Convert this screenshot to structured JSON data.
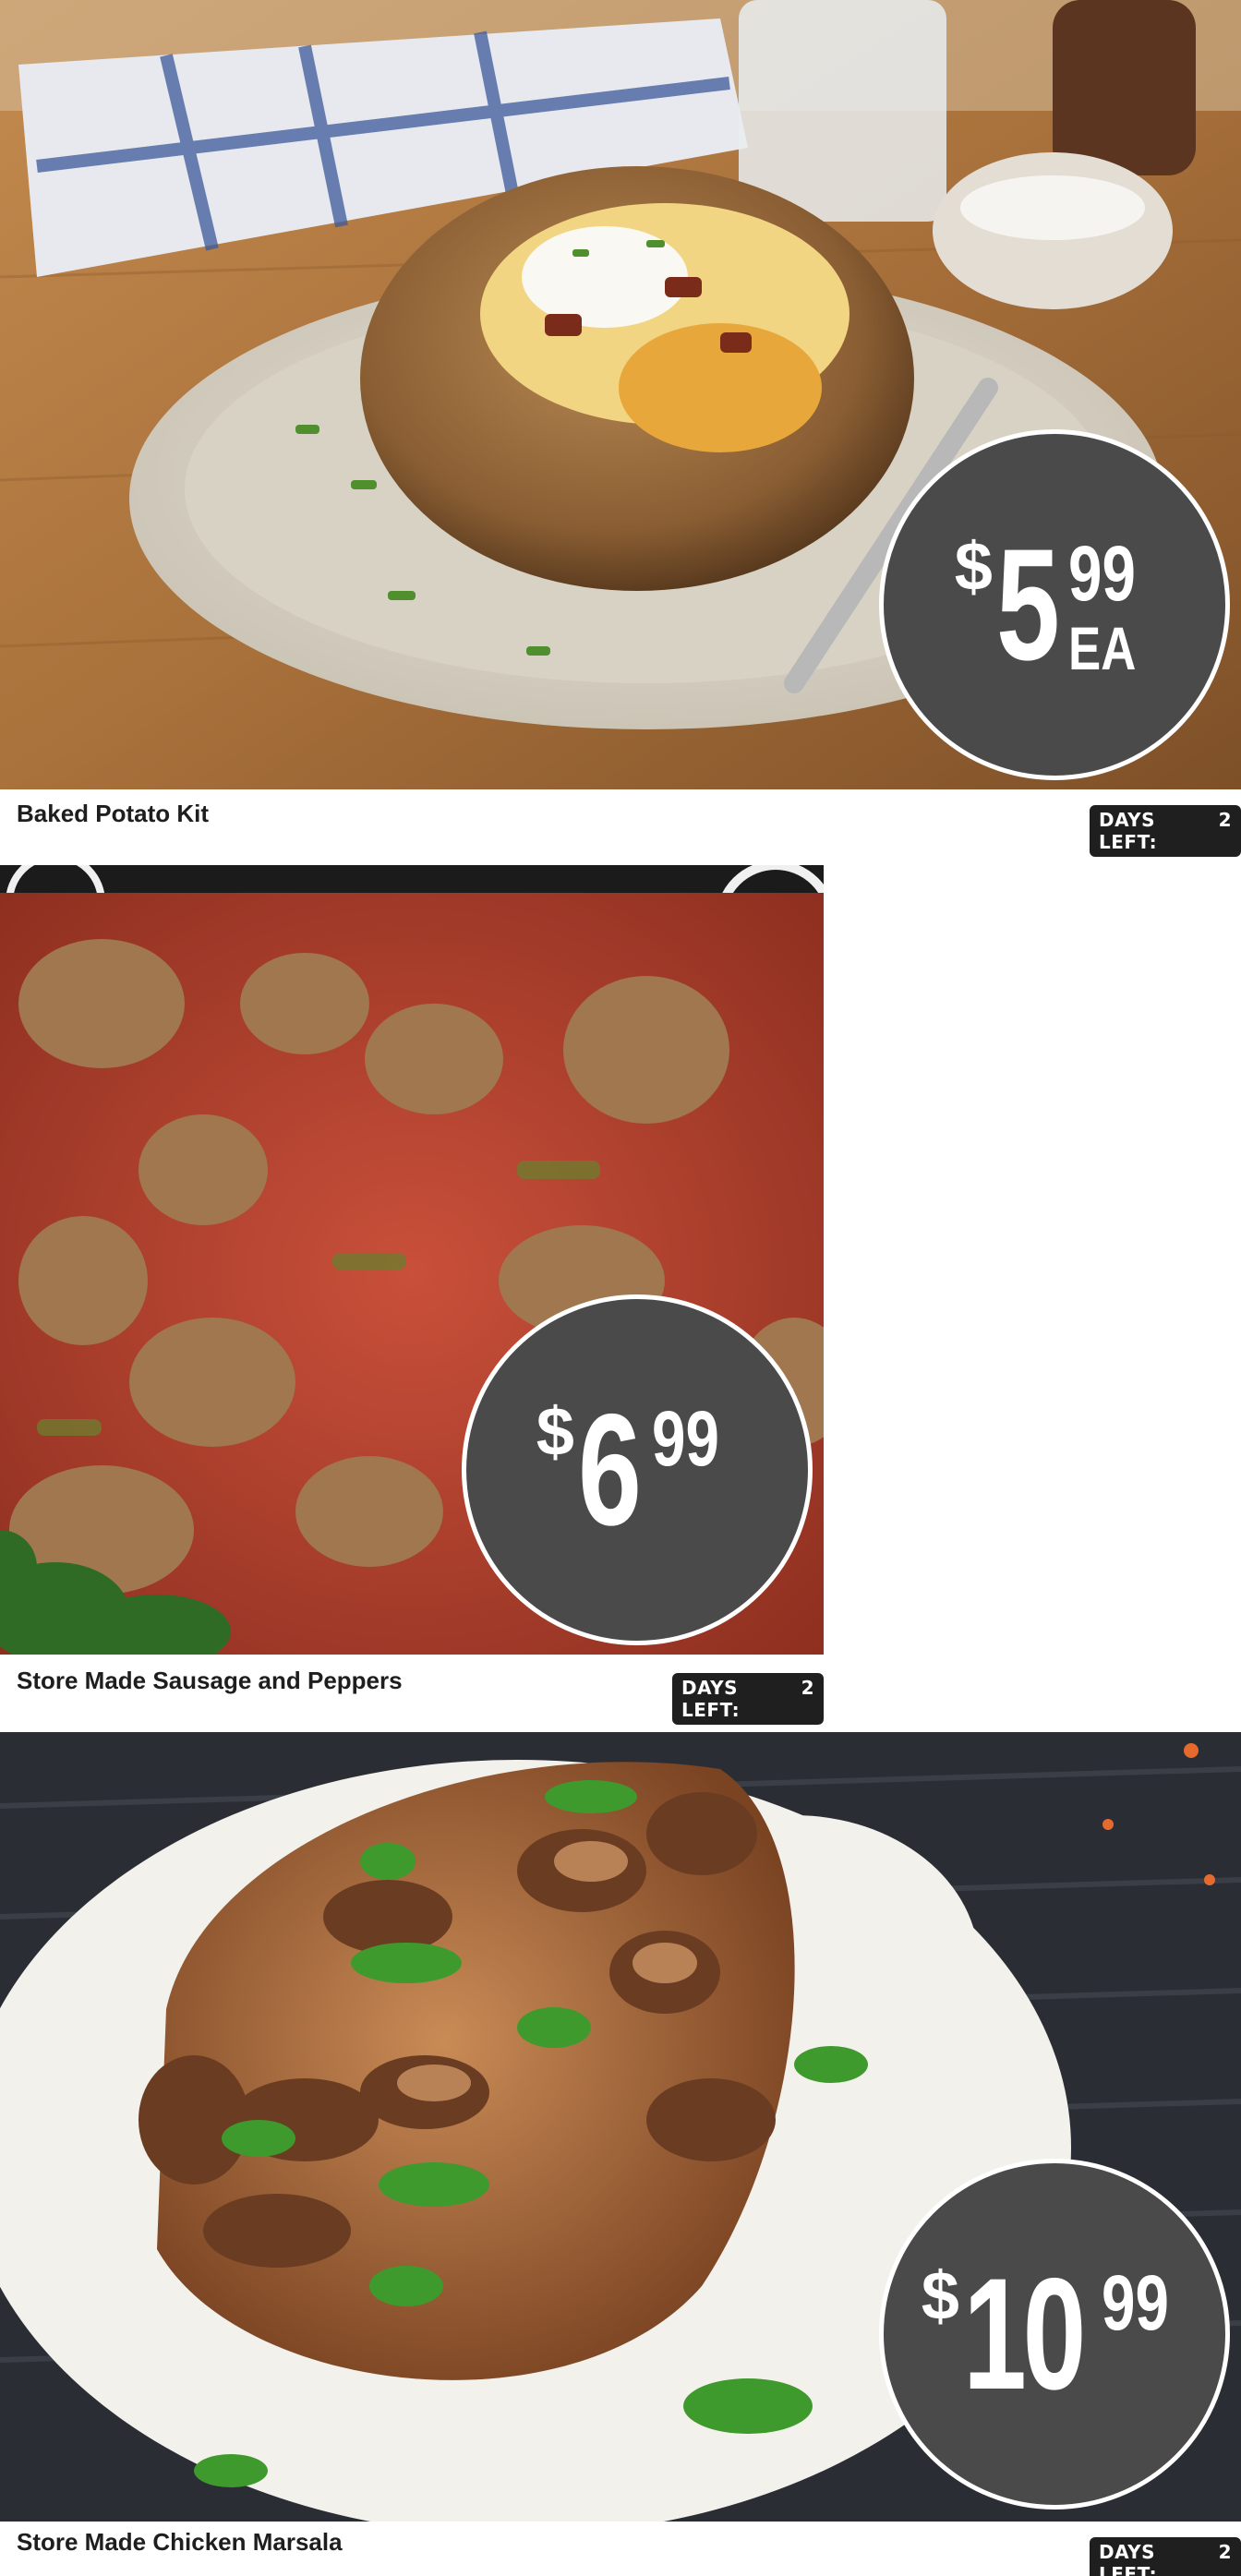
{
  "items": [
    {
      "name": "Baked Potato Kit",
      "price": {
        "dollar_sign": "$",
        "whole": "5",
        "cents": "99",
        "unit": "EA"
      },
      "days_left_label": "DAYS LEFT:",
      "days_left_value": "2"
    },
    {
      "name": "Store Made Sausage and Peppers",
      "price": {
        "dollar_sign": "$",
        "whole": "6",
        "cents": "99",
        "unit": ""
      },
      "days_left_label": "DAYS LEFT:",
      "days_left_value": "2"
    },
    {
      "name": "Store Made Chicken Marsala",
      "price": {
        "dollar_sign": "$",
        "whole": "10",
        "cents": "99",
        "unit": ""
      },
      "days_left_label": "DAYS LEFT:",
      "days_left_value": "2"
    }
  ],
  "colors": {
    "badge_fill": "#4a4a4a",
    "days_badge": "#1f1f1f",
    "caption_text": "#1e1e1e"
  }
}
